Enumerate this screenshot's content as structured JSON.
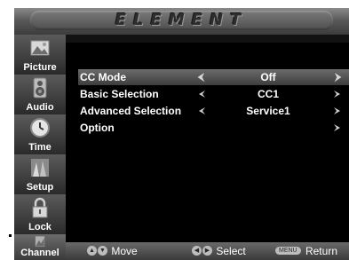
{
  "brand": "ELEMENT",
  "sidebar": {
    "items": [
      {
        "label": "Picture",
        "icon": "picture-icon"
      },
      {
        "label": "Audio",
        "icon": "speaker-icon"
      },
      {
        "label": "Time",
        "icon": "clock-icon"
      },
      {
        "label": "Setup",
        "icon": "setup-icon"
      },
      {
        "label": "Lock",
        "icon": "padlock-icon"
      },
      {
        "label": "Channel",
        "icon": "channel-icon"
      }
    ]
  },
  "menu": {
    "rows": [
      {
        "label": "CC Mode",
        "value": "Off",
        "selected": true
      },
      {
        "label": "Basic Selection",
        "value": "CC1",
        "selected": false
      },
      {
        "label": "Advanced Selection",
        "value": "Service1",
        "selected": false
      },
      {
        "label": "Option",
        "value": "",
        "selected": false
      }
    ]
  },
  "footer": {
    "move_label": "Move",
    "select_label": "Select",
    "menu_key": "MENU",
    "return_label": "Return"
  },
  "colors": {
    "background": "#000000",
    "bar": "#5a5a5a",
    "text": "#ffffff"
  }
}
